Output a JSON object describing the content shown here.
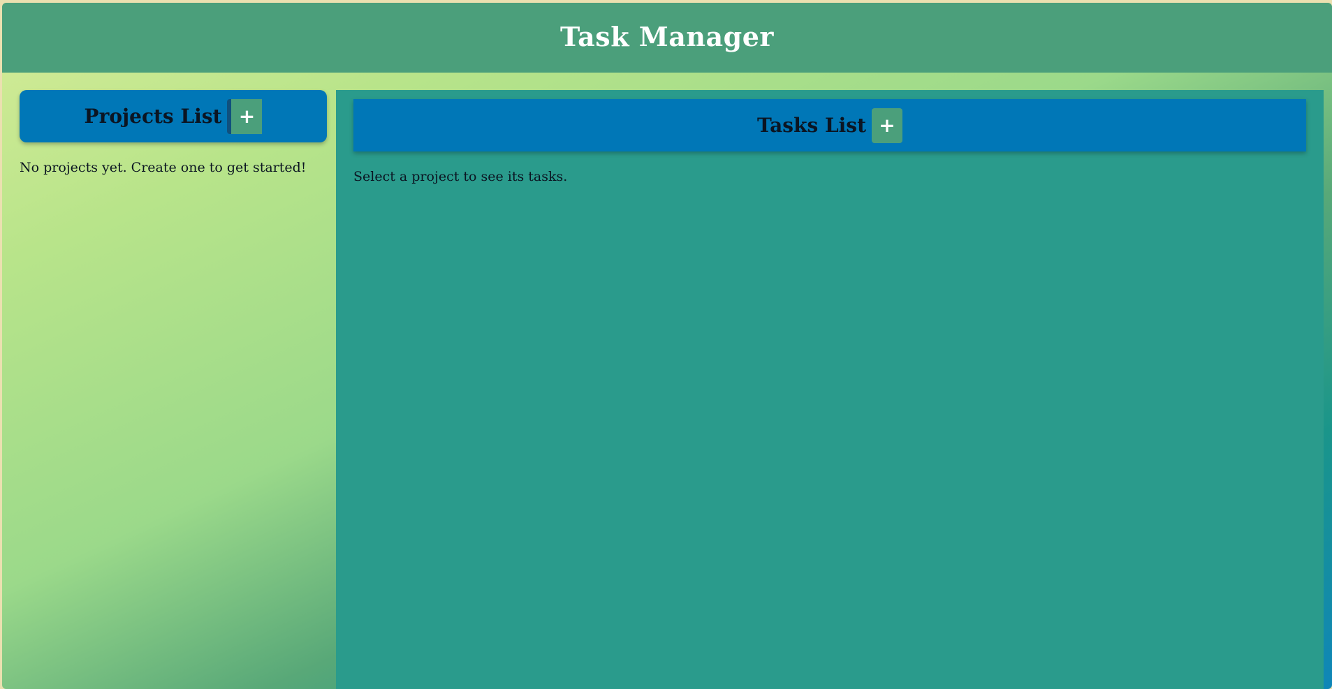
{
  "header": {
    "title": "Task Manager"
  },
  "projects": {
    "title": "Projects List",
    "add_label": "+",
    "empty_message": "No projects yet. Create one to get started!"
  },
  "tasks": {
    "title": "Tasks List",
    "add_label": "+",
    "empty_message": "Select a project to see its tasks."
  },
  "colors": {
    "header_bg": "#4b9f7b",
    "section_header_bg": "#0077b7",
    "tasks_panel_bg": "#2a9b8c",
    "add_button_bg": "#4b9f7b"
  },
  "icons": {
    "add_projects": "plus-icon",
    "add_tasks": "plus-icon"
  }
}
